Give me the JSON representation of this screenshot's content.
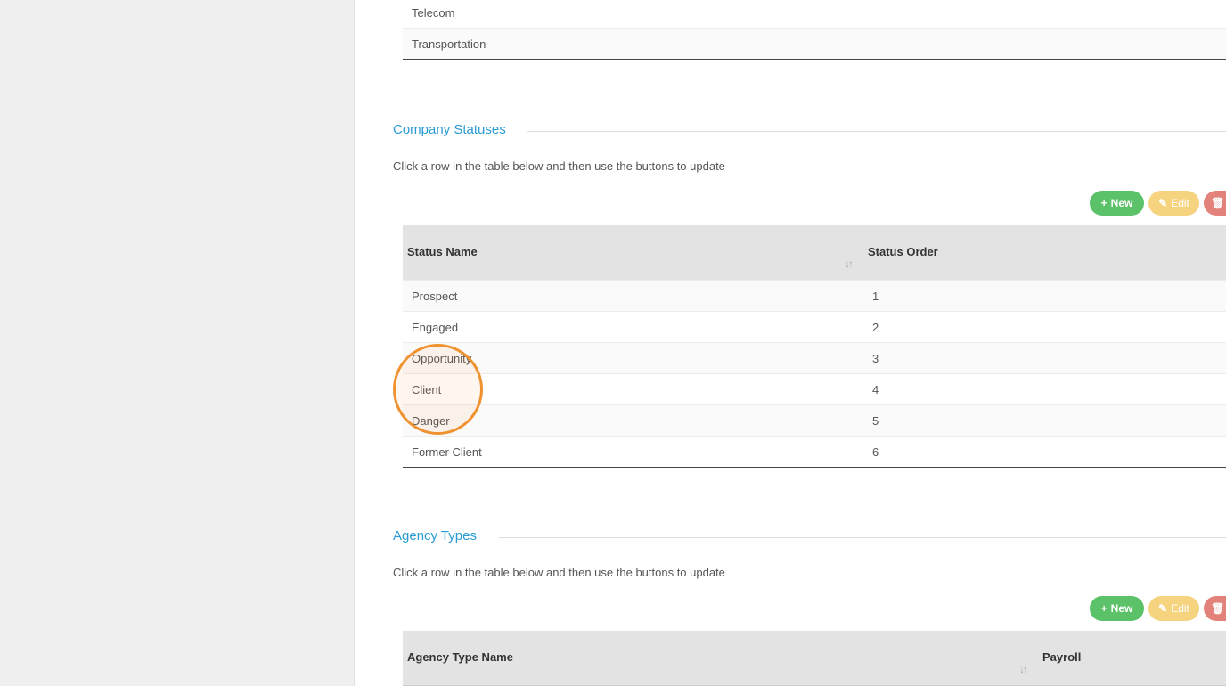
{
  "industries": {
    "rows": [
      "Telecom",
      "Transportation"
    ]
  },
  "company_statuses": {
    "title": "Company Statuses",
    "hint": "Click a row in the table below and then use the buttons to update",
    "buttons": {
      "new": "New",
      "edit": "Edit"
    },
    "columns": [
      "Status Name",
      "Status Order"
    ],
    "rows": [
      {
        "name": "Prospect",
        "order": "1"
      },
      {
        "name": "Engaged",
        "order": "2"
      },
      {
        "name": "Opportunity",
        "order": "3"
      },
      {
        "name": "Client",
        "order": "4"
      },
      {
        "name": "Danger",
        "order": "5"
      },
      {
        "name": "Former Client",
        "order": "6"
      }
    ]
  },
  "agency_types": {
    "title": "Agency Types",
    "hint": "Click a row in the table below and then use the buttons to update",
    "buttons": {
      "new": "New",
      "edit": "Edit"
    },
    "columns": [
      "Agency Type Name",
      "Payroll"
    ]
  },
  "icons": {
    "new": "plus-icon",
    "edit": "pencil-icon",
    "delete": "trash-icon",
    "sort": "sort-icon"
  },
  "colors": {
    "accent": "#2a9bd5",
    "new_button": "#5cc26a",
    "edit_button": "#f6d37f",
    "delete_button": "#e3827a",
    "highlight": "#f0922f"
  }
}
